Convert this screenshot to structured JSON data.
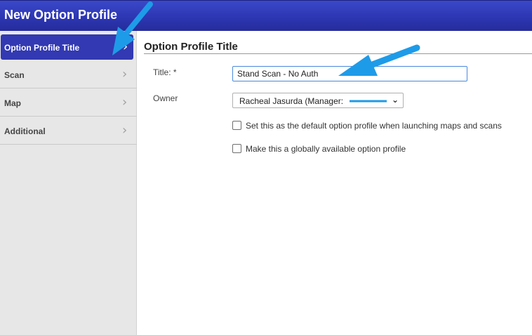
{
  "window": {
    "title": "New Option Profile"
  },
  "sidebar": {
    "items": [
      {
        "label": "Option Profile Title",
        "active": true
      },
      {
        "label": "Scan",
        "active": false
      },
      {
        "label": "Map",
        "active": false
      },
      {
        "label": "Additional",
        "active": false
      }
    ],
    "chevron_icon": "chevron-right-icon"
  },
  "main": {
    "heading": "Option Profile Title",
    "title_field": {
      "label": "Title: *",
      "value": "Stand Scan - No Auth"
    },
    "owner_field": {
      "label": "Owner",
      "selected": "Racheal Jasurda (Manager:"
    },
    "checkboxes": [
      {
        "label": "Set this as the default option profile when launching maps and scans",
        "checked": false
      },
      {
        "label": "Make this a globally available option profile",
        "checked": false
      }
    ]
  },
  "colors": {
    "title_bar": "#2d36b3",
    "active_nav": "#3239b2",
    "annotation_arrow": "#1e9be8",
    "input_focus_border": "#4a89dc"
  }
}
